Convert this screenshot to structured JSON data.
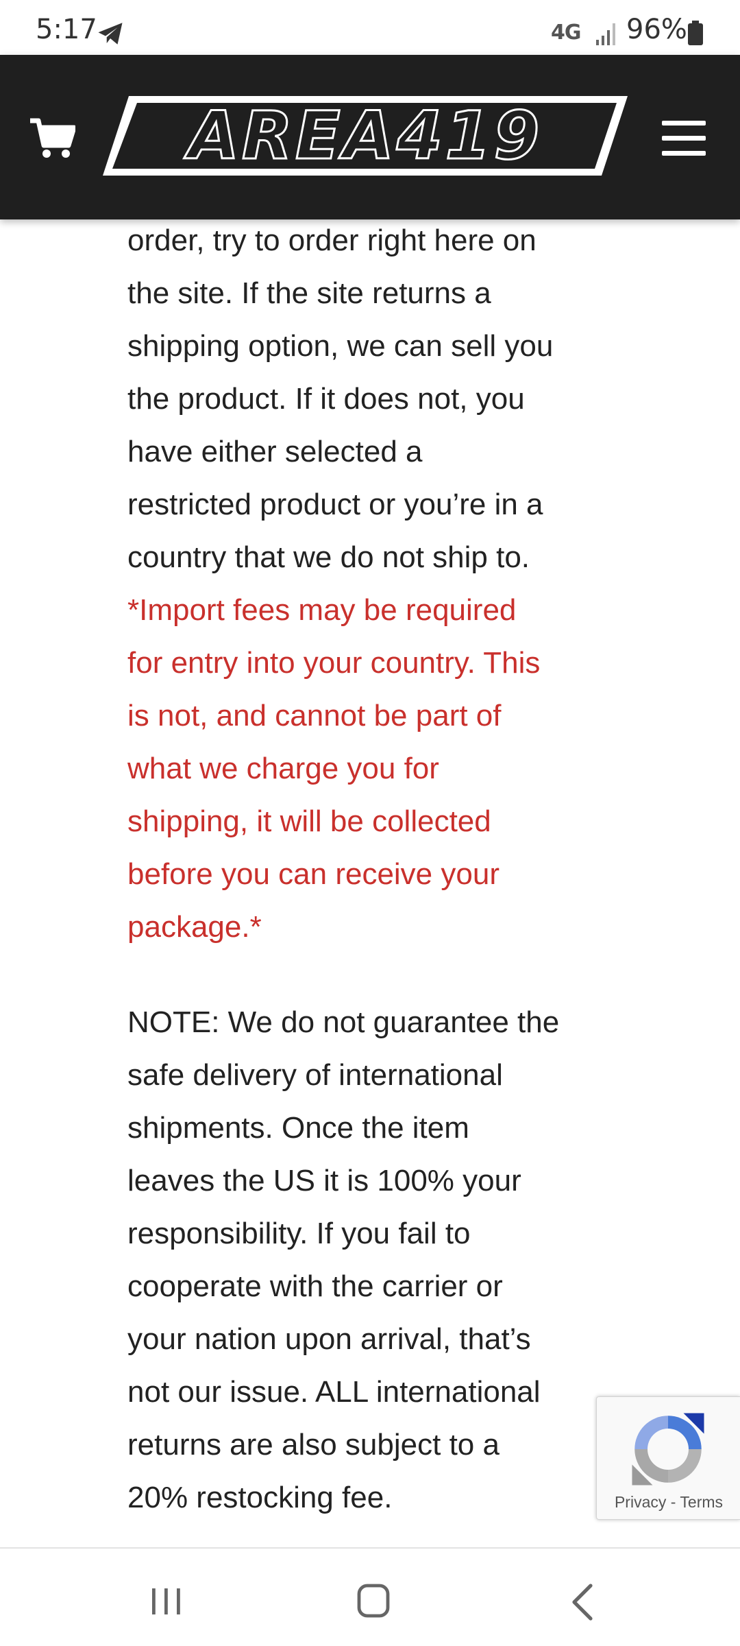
{
  "status_bar": {
    "time": "5:17",
    "network": "4G",
    "battery": "96%"
  },
  "header": {
    "logo_text": "AREA419",
    "cart_icon": "cart-icon",
    "menu_icon": "hamburger-menu-icon",
    "background_color": "#1f1f1f"
  },
  "content": {
    "intro_lines": [
      "order, try to order right here on",
      "the site. If the site returns a",
      "shipping option, we can sell you",
      "the product. If it does not, you",
      "have either selected a",
      "restricted product or you’re in a",
      "country that we do not ship to."
    ],
    "warning_lines": [
      "*Import fees may be required",
      "for entry into your country. This",
      "is not, and cannot be part of",
      "what we charge you for",
      "shipping, it will be collected",
      "before you can receive your",
      "package.*"
    ],
    "warning_color": "#c9302c",
    "note_lines": [
      "NOTE: We do not guarantee the",
      "safe delivery of international",
      "shipments. Once the item",
      "leaves the US it is 100% your",
      "responsibility. If you fail to",
      "cooperate with the carrier or",
      "your nation upon arrival, that’s",
      "not our issue. ALL international",
      "returns are also subject to a",
      "20% restocking fee."
    ]
  },
  "recaptcha": {
    "privacy_label": "Privacy",
    "separator": " - ",
    "terms_label": "Terms"
  },
  "nav_bar": {
    "recents_icon": "recents-icon",
    "home_icon": "home-icon",
    "back_icon": "back-icon"
  }
}
